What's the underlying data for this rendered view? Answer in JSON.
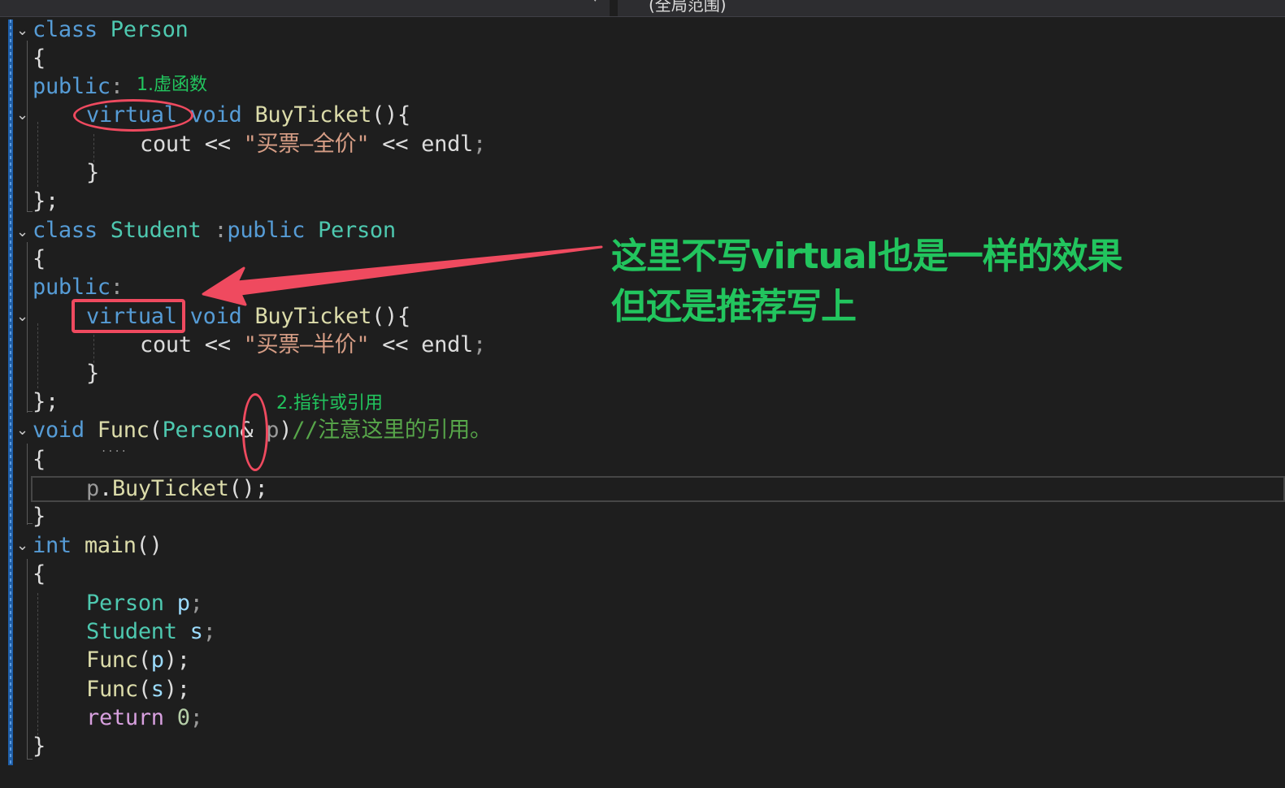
{
  "toolbar": {
    "scope_label": "(全局范围)",
    "dropdown_arrow": "⌄"
  },
  "code": {
    "l1": {
      "kw": "class",
      "name": "Person"
    },
    "l2": {
      "t": "{"
    },
    "l3": {
      "kw": "public",
      "p": ":"
    },
    "l4": {
      "kw1": "virtual",
      "kw2": "void",
      "fn": "BuyTicket",
      "p": "(){"
    },
    "l5": {
      "id": "cout",
      "op1": " << ",
      "str": "\"买票—全价\"",
      "op2": " << ",
      "id2": "endl",
      "p": ";"
    },
    "l6": {
      "t": "}"
    },
    "l7": {
      "t": "};"
    },
    "l8": {
      "kw": "class",
      "name": "Student",
      "sep": " :",
      "kw2": "public",
      "base": "Person"
    },
    "l9": {
      "t": "{"
    },
    "l10": {
      "kw": "public",
      "p": ":"
    },
    "l11": {
      "kw1": "virtual",
      "kw2": "void",
      "fn": "BuyTicket",
      "p": "(){"
    },
    "l12": {
      "id": "cout",
      "op1": " << ",
      "str": "\"买票—半价\"",
      "op2": " << ",
      "id2": "endl",
      "p": ";"
    },
    "l13": {
      "t": "}"
    },
    "l14": {
      "t": "};"
    },
    "l15": {
      "kw": "void",
      "fn": "Func",
      "p1": "(",
      "ty": "Person",
      "amp": "&",
      "par": " p",
      "p2": ")",
      "cm": "//注意这里的引用。"
    },
    "l16": {
      "t": "{"
    },
    "l17": {
      "par": "p",
      "dot": ".",
      "fn": "BuyTicket",
      "p": "();"
    },
    "l18": {
      "t": "}"
    },
    "l19": {
      "kw": "int",
      "fn": "main",
      "p": "()"
    },
    "l20": {
      "t": "{"
    },
    "l21": {
      "ty": "Person",
      "var": "p",
      "p": ";"
    },
    "l22": {
      "ty": "Student",
      "var": "s",
      "p": ";"
    },
    "l23": {
      "fn": "Func",
      "p1": "(",
      "var": "p",
      "p2": ");"
    },
    "l24": {
      "fn": "Func",
      "p1": "(",
      "var": "s",
      "p2": ");"
    },
    "l25": {
      "kw": "return",
      "num": "0",
      "p": ";"
    },
    "l26": {
      "t": "}"
    }
  },
  "annotations": {
    "virtual_function": "1.虚函数",
    "pointer_or_reference": "2.指针或引用",
    "note_line1": "这里不写virtual也是一样的效果",
    "note_line2": "但还是推荐写上"
  },
  "colors": {
    "annotation_text": "#22c55e",
    "markup_red": "#ef4a5f",
    "keyword": "#569cd6",
    "type": "#4ec9b0",
    "string": "#d69d85",
    "comment": "#57a64a"
  }
}
